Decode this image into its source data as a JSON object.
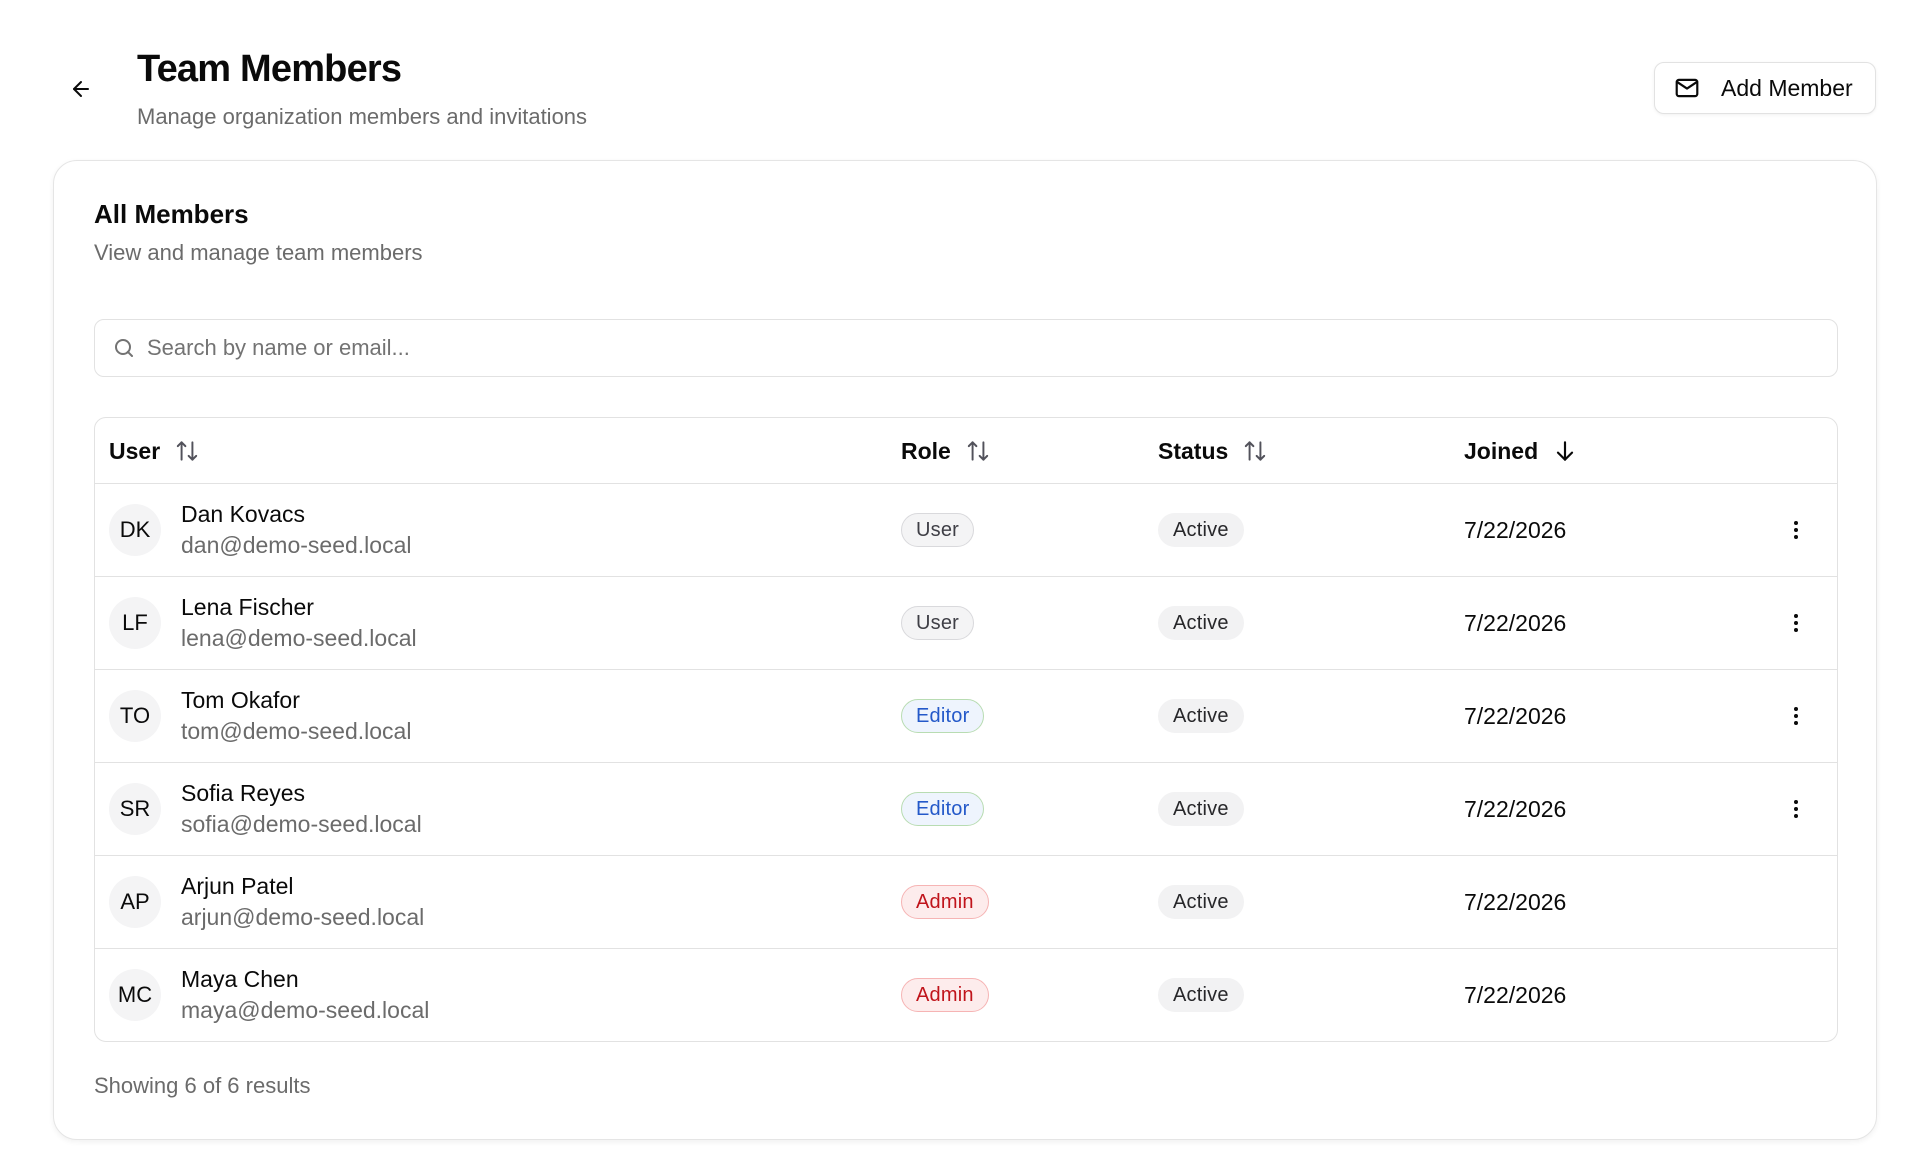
{
  "header": {
    "title": "Team Members",
    "subtitle": "Manage organization members and invitations",
    "back_icon": "arrow-left-icon",
    "add_button_label": "Add Member",
    "add_button_icon": "mail-icon"
  },
  "card": {
    "title": "All Members",
    "description": "View and manage team members"
  },
  "search": {
    "placeholder": "Search by name or email...",
    "value": "",
    "icon": "search-icon"
  },
  "table": {
    "columns": [
      {
        "label": "User",
        "sort": "unsorted"
      },
      {
        "label": "Role",
        "sort": "unsorted"
      },
      {
        "label": "Status",
        "sort": "unsorted"
      },
      {
        "label": "Joined",
        "sort": "descending"
      }
    ],
    "rows": [
      {
        "initials": "DK",
        "name": "Dan Kovacs",
        "email": "dan@demo-seed.local",
        "role": "User",
        "role_type": "user",
        "status": "Active",
        "joined": "7/22/2026",
        "has_actions": true
      },
      {
        "initials": "LF",
        "name": "Lena Fischer",
        "email": "lena@demo-seed.local",
        "role": "User",
        "role_type": "user",
        "status": "Active",
        "joined": "7/22/2026",
        "has_actions": true
      },
      {
        "initials": "TO",
        "name": "Tom Okafor",
        "email": "tom@demo-seed.local",
        "role": "Editor",
        "role_type": "editor",
        "status": "Active",
        "joined": "7/22/2026",
        "has_actions": true
      },
      {
        "initials": "SR",
        "name": "Sofia Reyes",
        "email": "sofia@demo-seed.local",
        "role": "Editor",
        "role_type": "editor",
        "status": "Active",
        "joined": "7/22/2026",
        "has_actions": true
      },
      {
        "initials": "AP",
        "name": "Arjun Patel",
        "email": "arjun@demo-seed.local",
        "role": "Admin",
        "role_type": "admin",
        "status": "Active",
        "joined": "7/22/2026",
        "has_actions": false
      },
      {
        "initials": "MC",
        "name": "Maya Chen",
        "email": "maya@demo-seed.local",
        "role": "Admin",
        "role_type": "admin",
        "status": "Active",
        "joined": "7/22/2026",
        "has_actions": false
      }
    ]
  },
  "footer": {
    "results_text": "Showing 6 of 6 results"
  },
  "colors": {
    "editor_text": "#2459c9",
    "admin_text": "#c0141b",
    "muted_text": "#6b6b6b"
  }
}
